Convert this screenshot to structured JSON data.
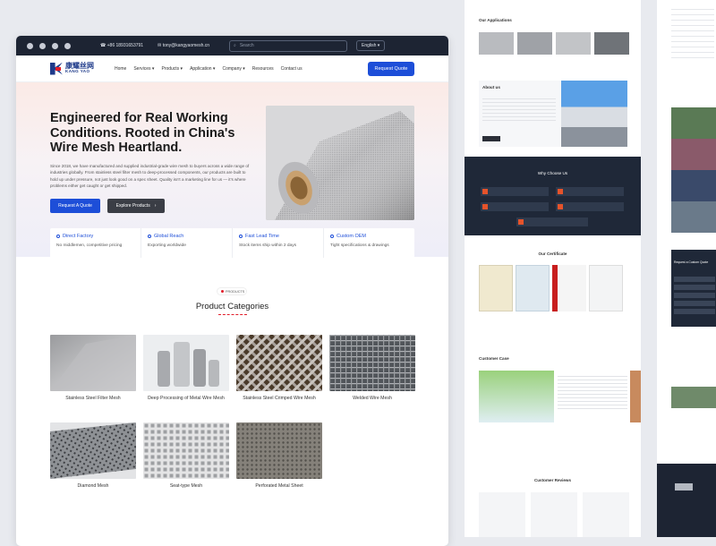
{
  "topbar": {
    "phone": "+86 18931653791",
    "email": "tony@kangyaomesh.cn",
    "search_placeholder": "Search",
    "language": "English"
  },
  "nav": {
    "logo_cn": "康耀丝网",
    "logo_en": "KANG YAO",
    "items": [
      "Home",
      "Services",
      "Products",
      "Application",
      "Company",
      "Resources",
      "Contact us"
    ],
    "cta": "Request Quote"
  },
  "hero": {
    "title": "Engineered for Real Working Conditions. Rooted in China's Wire Mesh Heartland.",
    "body": "Since 2018, we have manufactured and supplied industrial-grade wire mesh to buyers across a wide range of industries globally. From stainless steel filter mesh to deep-processed components, our products are built to hold up under pressure, not just look good on a spec sheet. Quality isn't a marketing line for us — it's where problems either get caught or get shipped.",
    "primary_btn": "Request A Quote",
    "secondary_btn": "Explore Products"
  },
  "features": [
    {
      "title": "Direct Factory",
      "sub": "No middlemen, competitive pricing"
    },
    {
      "title": "Global Reach",
      "sub": "Exporting worldwide"
    },
    {
      "title": "Fast Lead Time",
      "sub": "Stock items ship within 2 days"
    },
    {
      "title": "Custom OEM",
      "sub": "Tight specifications & drawings"
    }
  ],
  "categories": {
    "pill": "PRODUCTS",
    "title": "Product Categories",
    "items": [
      {
        "label": "Stainless Steel Filter Mesh"
      },
      {
        "label": "Deep Processing of Metal Wire Mesh"
      },
      {
        "label": "Stainless Steel Crimped Wire Mesh"
      },
      {
        "label": "Welded Wire Mesh"
      },
      {
        "label": "Diamond Mesh"
      },
      {
        "label": "Seat-type Mesh"
      },
      {
        "label": "Perforated Metal Sheet"
      }
    ]
  },
  "side_sections": {
    "applications": "Our Applications",
    "about": "About us",
    "why": "Why Choose Us",
    "certificate": "Our Certificate",
    "cases": "Customer Case",
    "reviews": "Customer Reviews",
    "quote_form": "Request a Custom Quote"
  },
  "colors": {
    "accent": "#1d4ed8",
    "dark": "#1d2433",
    "red": "#e11d2a"
  }
}
